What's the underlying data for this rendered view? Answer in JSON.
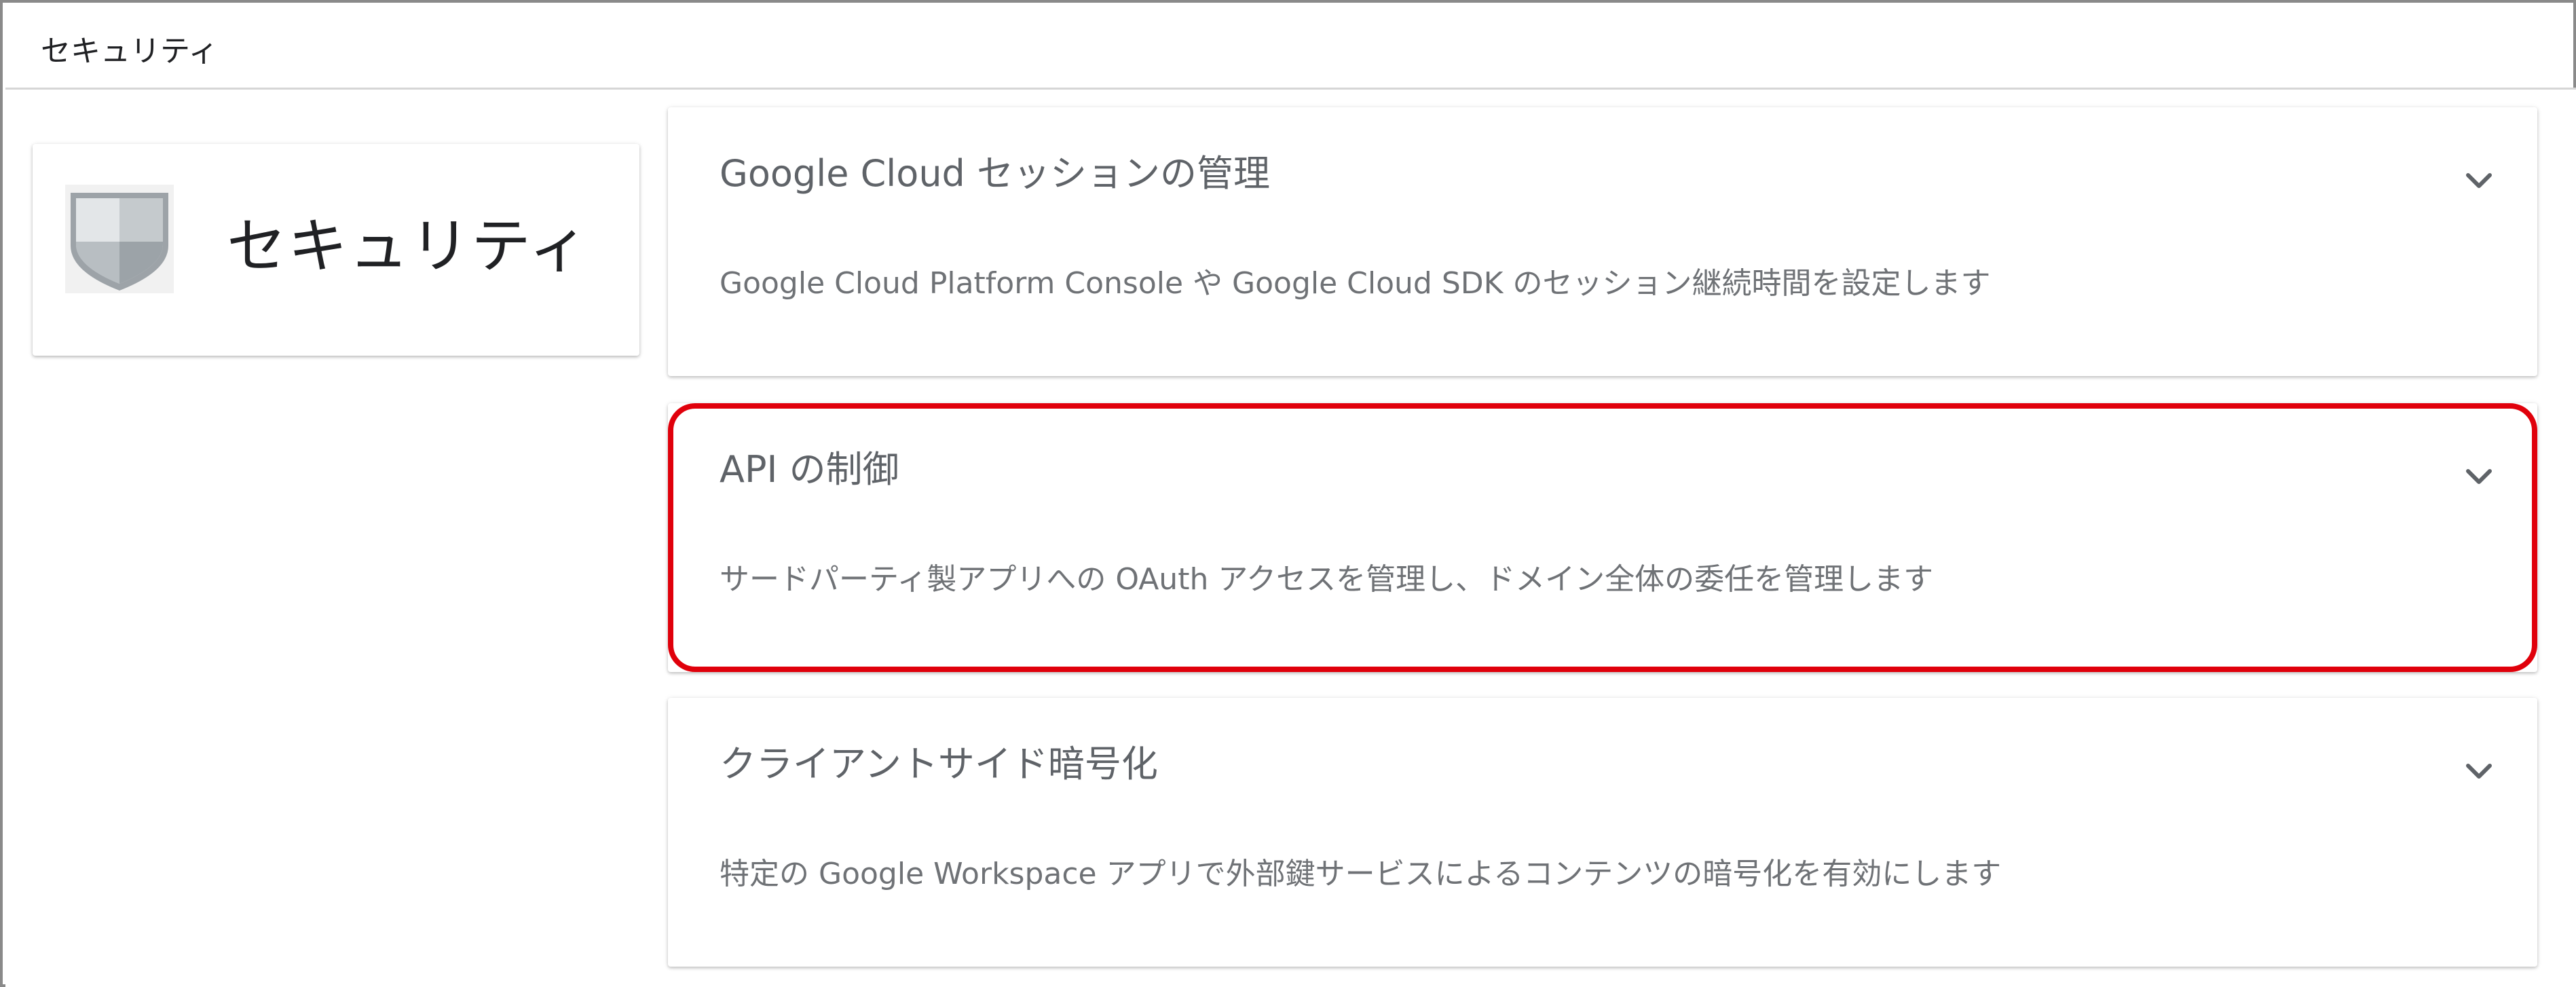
{
  "header": {
    "title": "セキュリティ"
  },
  "side_card": {
    "title": "セキュリティ",
    "icon": "shield-icon"
  },
  "panels": [
    {
      "title": "Google Cloud セッションの管理",
      "description": "Google Cloud Platform Console や Google Cloud SDK のセッション継続時間を設定します",
      "icon": "chevron-down-icon"
    },
    {
      "title": "API の制御",
      "description": "サードパーティ製アプリへの OAuth アクセスを管理し、ドメイン全体の委任を管理します",
      "icon": "chevron-down-icon",
      "highlighted": true
    },
    {
      "title": "クライアントサイド暗号化",
      "description": "特定の Google Workspace アプリで外部鍵サービスによるコンテンツの暗号化を有効にします",
      "icon": "chevron-down-icon"
    }
  ],
  "colors": {
    "highlight": "#e0000b",
    "title_text": "#5f6368",
    "description_text": "#6f7276"
  }
}
